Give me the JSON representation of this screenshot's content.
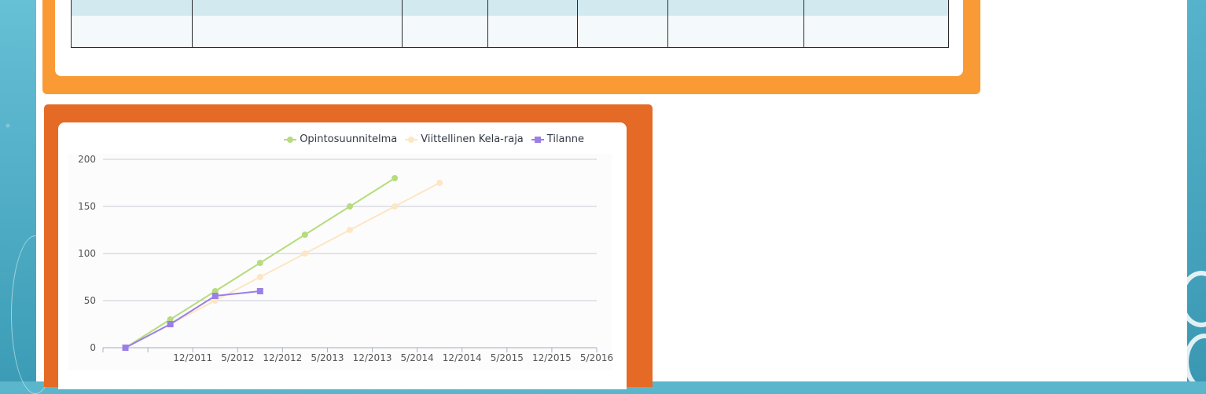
{
  "table": {
    "columns": 7,
    "rows": [
      [
        "",
        "",
        "",
        "",
        "",
        "",
        ""
      ],
      [
        "",
        "",
        "",
        "",
        "",
        "",
        ""
      ]
    ]
  },
  "chart_data": {
    "type": "line",
    "legend_position": "top-right",
    "grid": true,
    "categories": [
      "",
      "12/2011",
      "5/2012",
      "12/2012",
      "5/2013",
      "12/2013",
      "5/2014",
      "12/2014",
      "5/2015",
      "12/2015",
      "5/2016"
    ],
    "ylim": [
      0,
      200
    ],
    "yticks": [
      0,
      50,
      100,
      150,
      200
    ],
    "series": [
      {
        "name": "Opintosuunnitelma",
        "color": "#b6dc7f",
        "marker": "circle",
        "values": [
          0,
          30,
          60,
          90,
          120,
          150,
          180,
          null,
          null,
          null,
          null
        ]
      },
      {
        "name": "Viittellinen Kela-raja",
        "color": "#fde6c4",
        "marker": "circle",
        "values": [
          0,
          25,
          50,
          75,
          100,
          125,
          150,
          175,
          null,
          null,
          null
        ]
      },
      {
        "name": "Tilanne",
        "color": "#9b7fe6",
        "marker": "square",
        "values": [
          0,
          25,
          55,
          60,
          null,
          null,
          null,
          null,
          null,
          null,
          null
        ]
      }
    ]
  }
}
